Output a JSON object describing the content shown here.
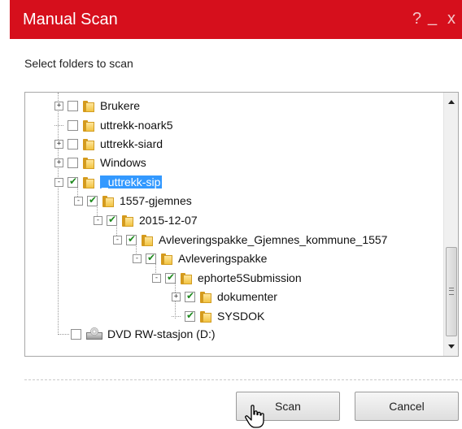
{
  "window": {
    "title": "Manual Scan",
    "help_glyph": "?",
    "minimize_glyph": "_",
    "close_glyph": "x"
  },
  "subtitle": "Select folders to scan",
  "tree": [
    {
      "label": "Brukere",
      "checked": false,
      "expander": "+",
      "icon": "folder-icon"
    },
    {
      "label": "uttrekk-noark5",
      "checked": false,
      "expander": "",
      "icon": "folder-icon"
    },
    {
      "label": "uttrekk-siard",
      "checked": false,
      "expander": "+",
      "icon": "folder-icon"
    },
    {
      "label": "Windows",
      "checked": false,
      "expander": "+",
      "icon": "folder-icon"
    },
    {
      "label": "_uttrekk-sip",
      "checked": true,
      "expander": "-",
      "icon": "folder-icon",
      "selected": true
    },
    {
      "label": "1557-gjemnes",
      "checked": true,
      "expander": "-",
      "icon": "folder-icon"
    },
    {
      "label": "2015-12-07",
      "checked": true,
      "expander": "-",
      "icon": "folder-icon"
    },
    {
      "label": "Avleveringspakke_Gjemnes_kommune_1557",
      "checked": true,
      "expander": "-",
      "icon": "folder-icon"
    },
    {
      "label": "Avleveringspakke",
      "checked": true,
      "expander": "-",
      "icon": "folder-icon"
    },
    {
      "label": "ephorte5Submission",
      "checked": true,
      "expander": "-",
      "icon": "folder-icon"
    },
    {
      "label": "dokumenter",
      "checked": true,
      "expander": "+",
      "icon": "folder-icon"
    },
    {
      "label": "SYSDOK",
      "checked": true,
      "expander": "",
      "icon": "folder-icon"
    },
    {
      "label": "DVD RW-stasjon (D:)",
      "checked": false,
      "expander": "",
      "icon": "dvd-drive-icon"
    }
  ],
  "buttons": {
    "scan": "Scan",
    "cancel": "Cancel"
  },
  "colors": {
    "titlebar": "#d60f1c",
    "selection": "#3399ff",
    "check": "#1f8a1f"
  }
}
